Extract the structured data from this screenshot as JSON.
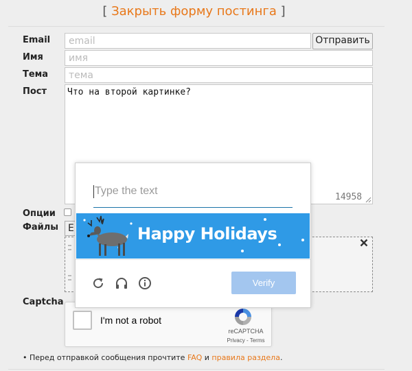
{
  "header": {
    "bracket_open": "[ ",
    "close_form_link": "Закрыть форму постинга",
    "bracket_close": " ]"
  },
  "form": {
    "email_label": "Email",
    "email_placeholder": "email",
    "submit_label": "Отправить",
    "name_label": "Имя",
    "name_placeholder": "имя",
    "subject_label": "Тема",
    "subject_placeholder": "тема",
    "post_label": "Пост",
    "post_text": "Что на второй картинке?",
    "char_counter": "14958",
    "options_label": "Опции",
    "files_label": "Файлы",
    "file_button_label": "E",
    "captcha_label": "Captcha"
  },
  "recaptcha": {
    "checkbox_label": "I'm not a robot",
    "brand": "reCAPTCHA",
    "privacy_link": "Privacy",
    "links_separator": " - ",
    "terms_link": "Terms"
  },
  "challenge": {
    "input_placeholder": "Type the text",
    "banner_text": "Happy Holidays",
    "verify_label": "Verify",
    "banner_color": "#2f9ae6",
    "verify_color": "#a3c6ef",
    "icons": [
      "reload-icon",
      "audio-icon",
      "info-icon"
    ]
  },
  "footer": {
    "prefix": "• Перед отправкой сообщения прочтите ",
    "faq_link": "FAQ",
    "middle": " и ",
    "rules_link": "правила раздела",
    "suffix": "."
  },
  "colors": {
    "accent_link": "#e8781a",
    "page_bg": "#eeeeee"
  }
}
